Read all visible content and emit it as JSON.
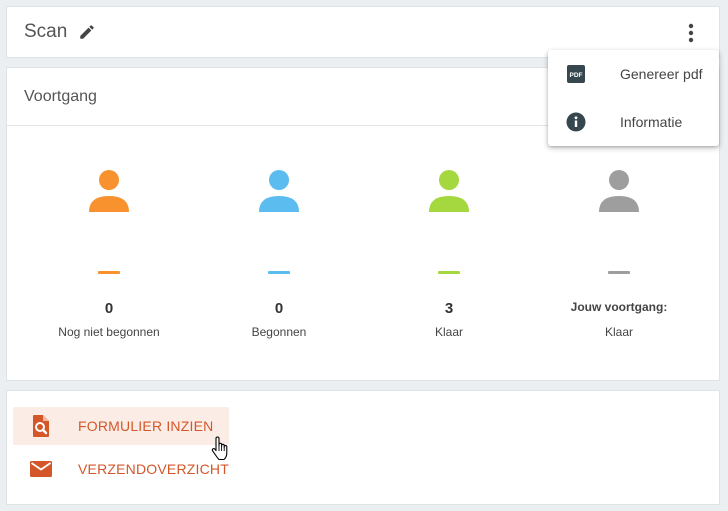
{
  "header": {
    "title": "Scan",
    "edit_icon": "pencil-icon",
    "more_icon": "more-vert-icon"
  },
  "progress": {
    "title": "Voortgang",
    "columns": [
      {
        "count": "0",
        "label": "Nog niet begonnen",
        "color": "#f7922e"
      },
      {
        "count": "0",
        "label": "Begonnen",
        "color": "#5bbcf0"
      },
      {
        "count": "3",
        "label": "Klaar",
        "color": "#a5d83e"
      }
    ],
    "own": {
      "label": "Jouw voortgang:",
      "value": "Klaar",
      "color": "#9e9e9e"
    }
  },
  "actions": [
    {
      "label": "FORMULIER INZIEN",
      "icon": "document-search-icon"
    },
    {
      "label": "VERZENDOVERZICHT",
      "icon": "mail-icon"
    }
  ],
  "menu": {
    "items": [
      {
        "label": "Genereer pdf",
        "icon": "pdf-icon"
      },
      {
        "label": "Informatie",
        "icon": "info-icon"
      }
    ]
  },
  "colors": {
    "accent": "#d4572a",
    "icon_dark": "#37474f"
  }
}
